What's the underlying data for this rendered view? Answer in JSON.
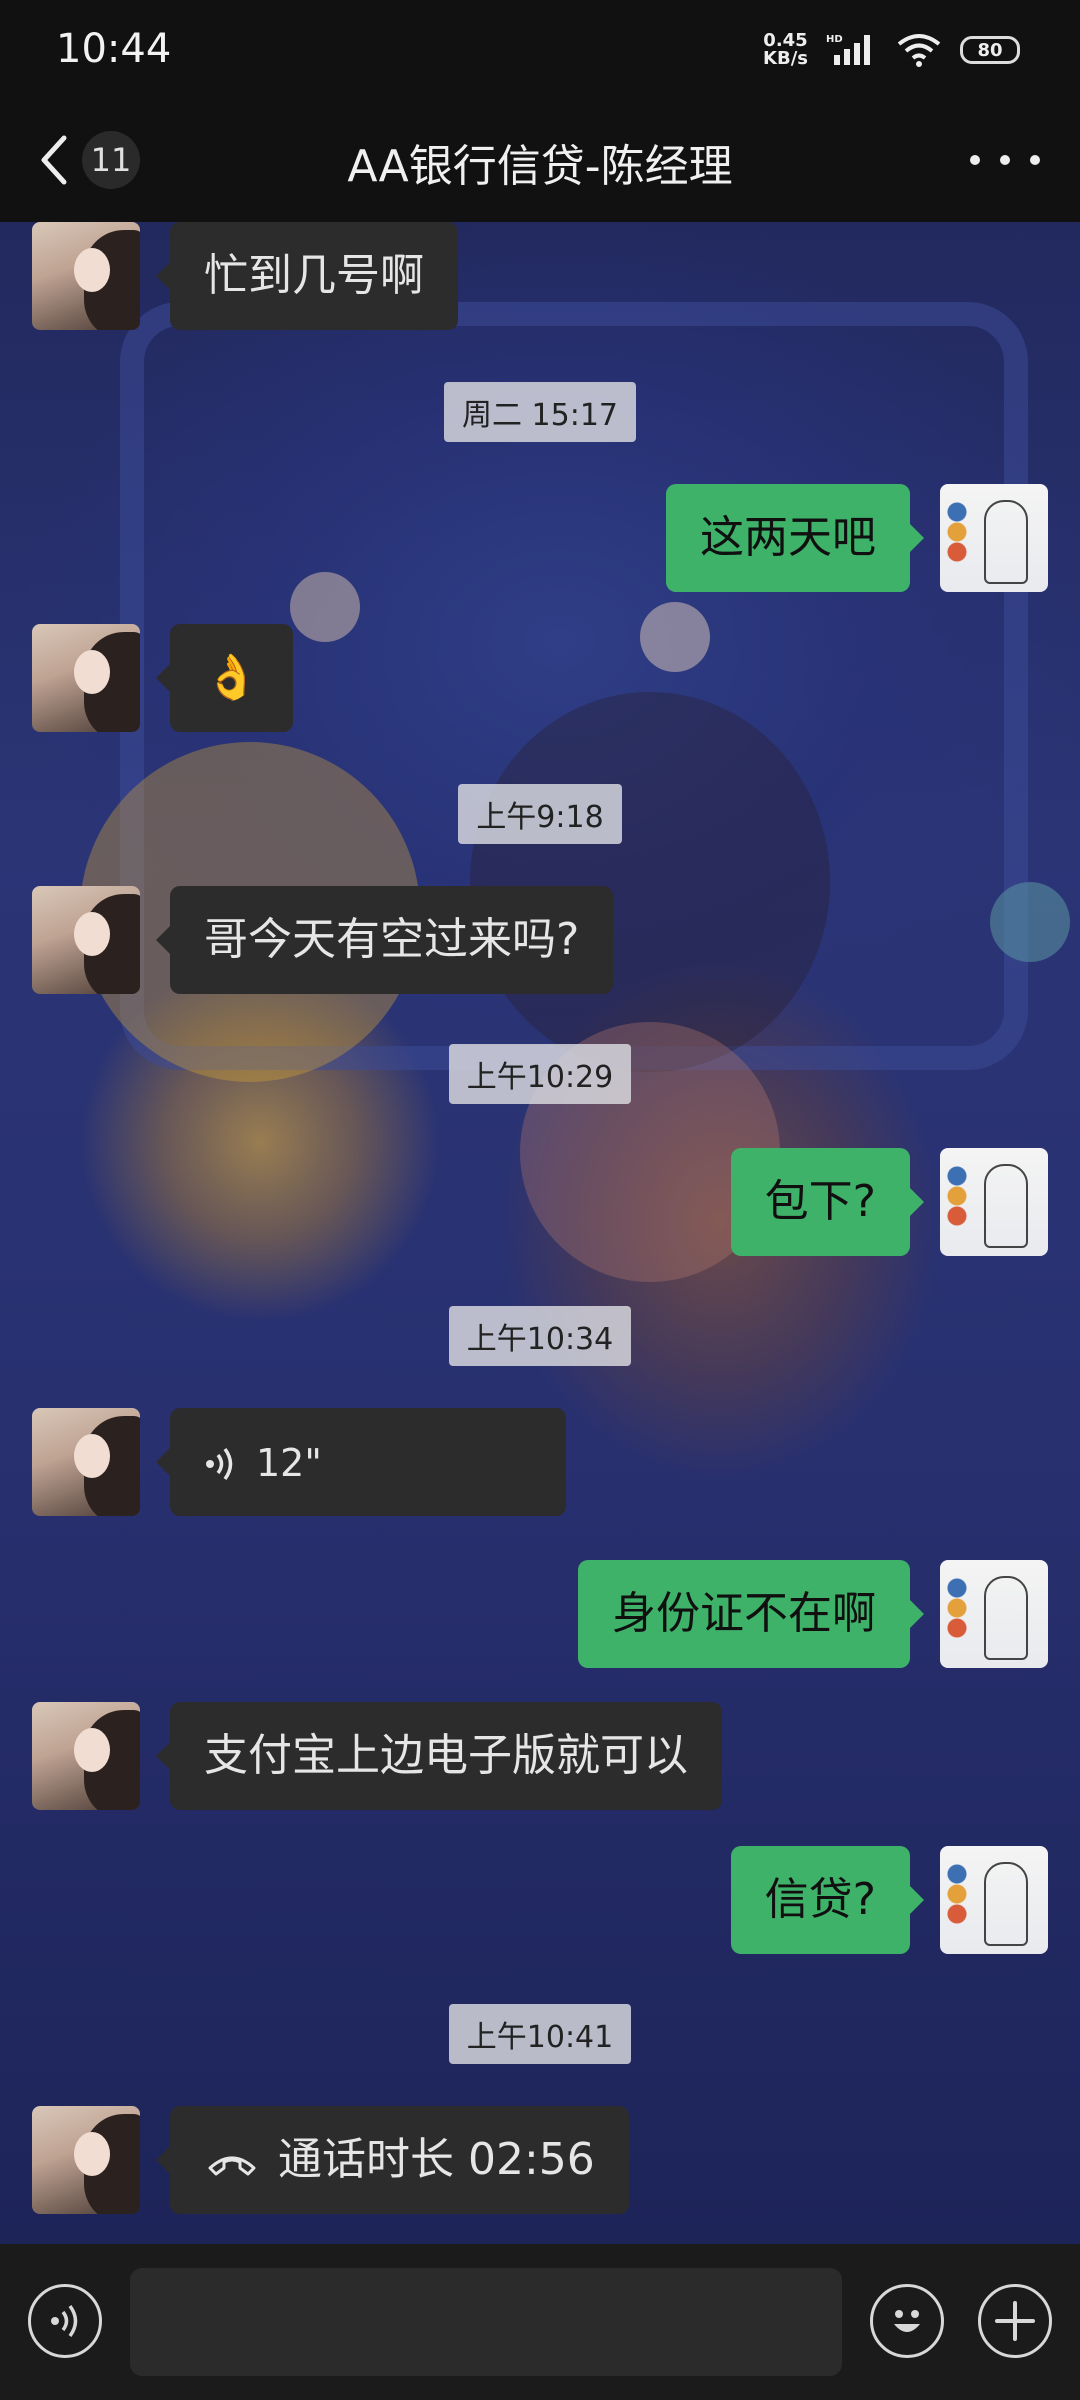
{
  "status_bar": {
    "time": "10:44",
    "net_speed_value": "0.45",
    "net_speed_unit": "KB/s",
    "network_label": "HD",
    "battery": "80"
  },
  "header": {
    "unread_count": "11",
    "title": "AA银行信贷-陈经理"
  },
  "messages": [
    {
      "type": "text",
      "side": "in",
      "text": "忙到几号啊"
    },
    {
      "type": "time",
      "text": "周二 15:17"
    },
    {
      "type": "text",
      "side": "out",
      "text": "这两天吧"
    },
    {
      "type": "text",
      "side": "in",
      "text": "👌"
    },
    {
      "type": "time",
      "text": "上午9:18"
    },
    {
      "type": "text",
      "side": "in",
      "text": "哥今天有空过来吗?"
    },
    {
      "type": "time",
      "text": "上午10:29"
    },
    {
      "type": "text",
      "side": "out",
      "text": "包下?"
    },
    {
      "type": "time",
      "text": "上午10:34"
    },
    {
      "type": "voice",
      "side": "in",
      "text": "12\""
    },
    {
      "type": "text",
      "side": "out",
      "text": "身份证不在啊"
    },
    {
      "type": "text",
      "side": "in",
      "text": "支付宝上边电子版就可以"
    },
    {
      "type": "text",
      "side": "out",
      "text": "信贷?"
    },
    {
      "type": "time",
      "text": "上午10:41"
    },
    {
      "type": "call",
      "side": "in",
      "text": "通话时长 02:56"
    }
  ],
  "input_bar": {
    "value": ""
  },
  "colors": {
    "out_bubble": "#3fb26a",
    "in_bubble": "#2c2c2c",
    "header_bg": "#111111"
  },
  "icons": [
    "back-arrow-icon",
    "more-dots-icon",
    "voice-icon",
    "call-icon",
    "voice-toggle-icon",
    "emoji-icon",
    "plus-icon"
  ]
}
